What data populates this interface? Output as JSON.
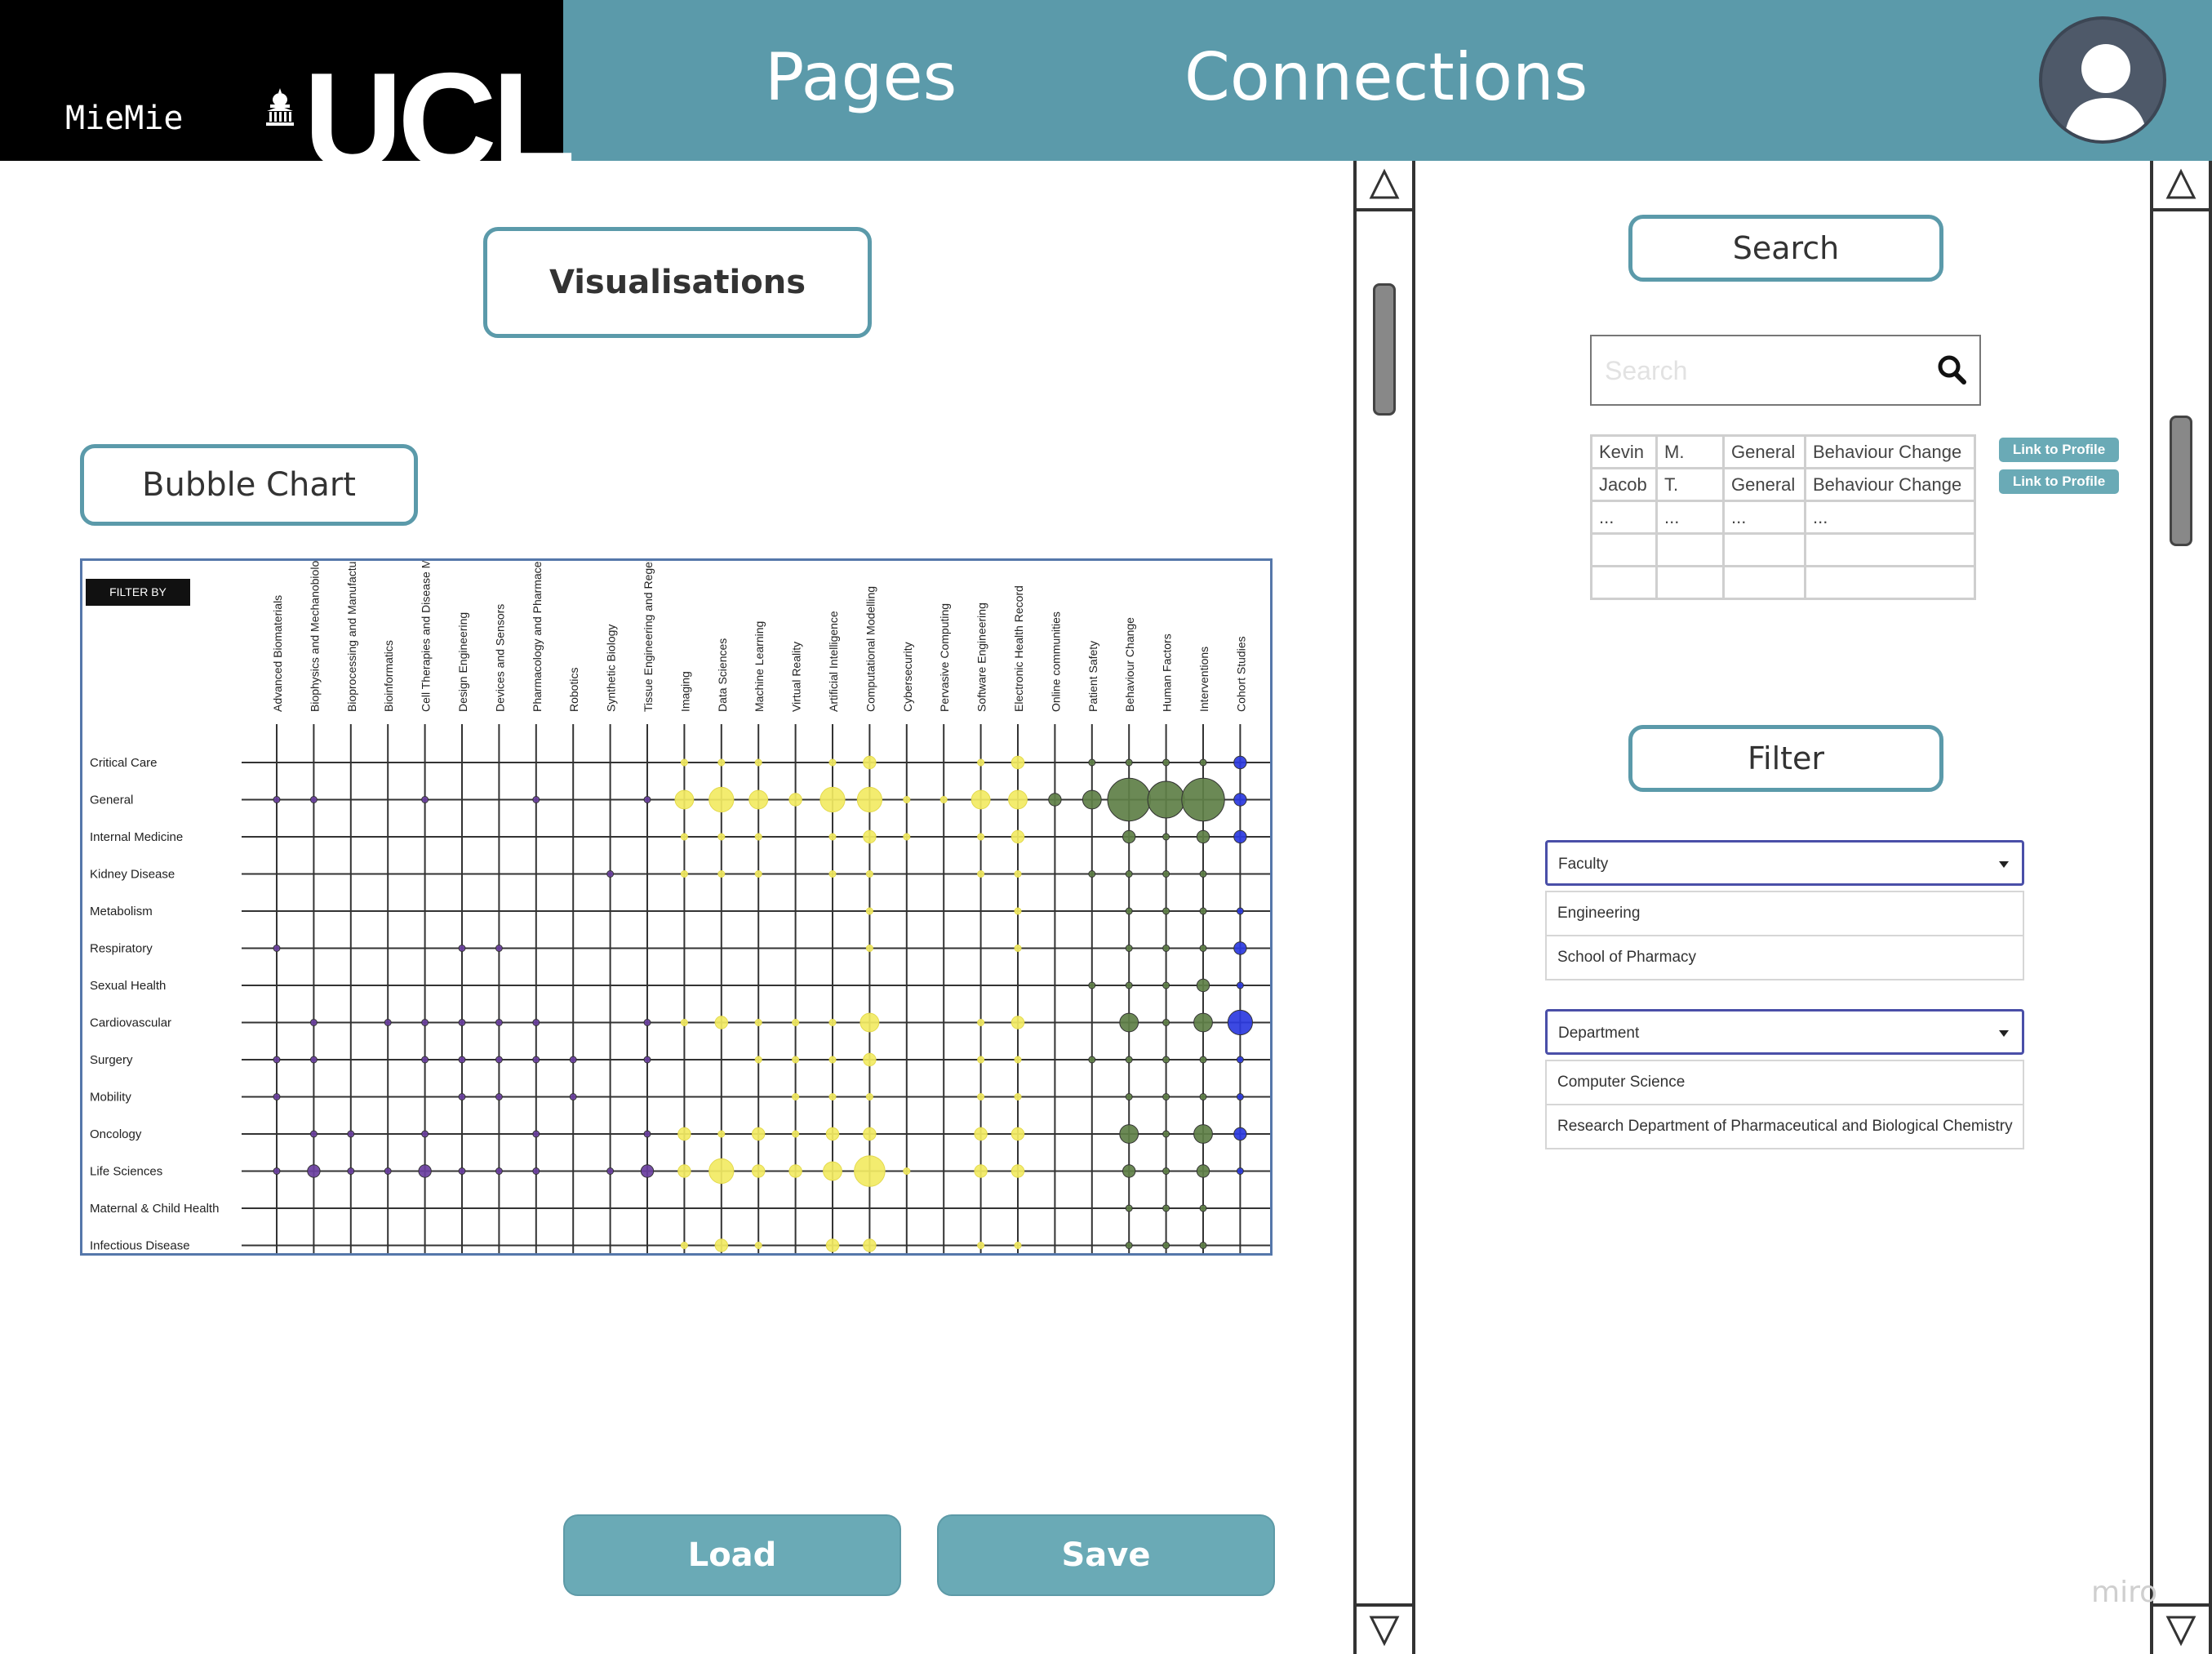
{
  "header": {
    "app_name": "MieMie",
    "logo_text": "UCL",
    "nav": [
      "Pages",
      "Connections"
    ]
  },
  "main": {
    "visualisations_label": "Visualisations",
    "bubble_chart_label": "Bubble Chart",
    "filter_by_label": "FILTER BY",
    "load_label": "Load",
    "save_label": "Save"
  },
  "chart_data": {
    "type": "bubble-matrix",
    "columns": [
      "Advanced Biomaterials",
      "Biophysics and Mechanobiology",
      "Bioprocessing and Manufacturing",
      "Bioinformatics",
      "Cell Therapies and Disease Models",
      "Design Engineering",
      "Devices and Sensors",
      "Pharmacology and Pharmaceuticals",
      "Robotics",
      "Synthetic Biology",
      "Tissue Engineering and Regenerative Medicine",
      "Imaging",
      "Data Sciences",
      "Machine Learning",
      "Virtual Reality",
      "Artificial Intelligence",
      "Computational Modelling",
      "Cybersecurity",
      "Pervasive Computing",
      "Software Engineering",
      "Electronic Health Record",
      "Online communities",
      "Patient Safety",
      "Behaviour Change",
      "Human Factors",
      "Interventions",
      "Cohort Studies"
    ],
    "rows": [
      "Critical Care",
      "General",
      "Internal Medicine",
      "Kidney Disease",
      "Metabolism",
      "Respiratory",
      "Sexual Health",
      "Cardiovascular",
      "Surgery",
      "Mobility",
      "Oncology",
      "Life Sciences",
      "Maternal & Child Health",
      "Infectious Disease"
    ],
    "column_groups": [
      {
        "color": "#6a3fa0",
        "from": 0,
        "to": 10
      },
      {
        "color": "#f2ea63",
        "from": 11,
        "to": 20
      },
      {
        "color": "#5e7f47",
        "from": 21,
        "to": 25
      },
      {
        "color": "#2b39e0",
        "from": 26,
        "to": 26
      }
    ],
    "bubble_sizes": [
      [
        0,
        0,
        0,
        0,
        0,
        0,
        0,
        0,
        0,
        0,
        0,
        1,
        1,
        1,
        0,
        1,
        2,
        0,
        0,
        1,
        2,
        0,
        1,
        1,
        1,
        1,
        2
      ],
      [
        1,
        1,
        0,
        0,
        1,
        0,
        0,
        1,
        0,
        0,
        1,
        3,
        4,
        3,
        2,
        4,
        4,
        1,
        1,
        3,
        3,
        2,
        3,
        7,
        6,
        7,
        2
      ],
      [
        0,
        0,
        0,
        0,
        0,
        0,
        0,
        0,
        0,
        0,
        0,
        1,
        1,
        1,
        0,
        1,
        2,
        1,
        0,
        1,
        2,
        0,
        0,
        2,
        1,
        2,
        2
      ],
      [
        0,
        0,
        0,
        0,
        0,
        0,
        0,
        0,
        0,
        1,
        0,
        1,
        1,
        1,
        0,
        1,
        1,
        0,
        0,
        1,
        1,
        0,
        1,
        1,
        1,
        1,
        0
      ],
      [
        0,
        0,
        0,
        0,
        0,
        0,
        0,
        0,
        0,
        0,
        0,
        0,
        0,
        0,
        0,
        0,
        1,
        0,
        0,
        0,
        1,
        0,
        0,
        1,
        1,
        1,
        1
      ],
      [
        1,
        0,
        0,
        0,
        0,
        1,
        1,
        0,
        0,
        0,
        0,
        0,
        0,
        0,
        0,
        0,
        1,
        0,
        0,
        0,
        1,
        0,
        0,
        1,
        1,
        1,
        2
      ],
      [
        0,
        0,
        0,
        0,
        0,
        0,
        0,
        0,
        0,
        0,
        0,
        0,
        0,
        0,
        0,
        0,
        0,
        0,
        0,
        0,
        0,
        0,
        1,
        1,
        1,
        2,
        1
      ],
      [
        0,
        1,
        0,
        1,
        1,
        1,
        1,
        1,
        0,
        0,
        1,
        1,
        2,
        1,
        1,
        1,
        3,
        0,
        0,
        1,
        2,
        0,
        0,
        3,
        1,
        3,
        4
      ],
      [
        1,
        1,
        0,
        0,
        1,
        1,
        1,
        1,
        1,
        0,
        1,
        0,
        0,
        1,
        1,
        1,
        2,
        0,
        0,
        1,
        1,
        0,
        1,
        1,
        1,
        1,
        1
      ],
      [
        1,
        0,
        0,
        0,
        0,
        1,
        1,
        0,
        1,
        0,
        0,
        0,
        0,
        0,
        1,
        1,
        1,
        0,
        0,
        1,
        1,
        0,
        0,
        1,
        1,
        1,
        1
      ],
      [
        0,
        1,
        1,
        0,
        1,
        0,
        0,
        1,
        0,
        0,
        1,
        2,
        1,
        2,
        1,
        2,
        2,
        0,
        0,
        2,
        2,
        0,
        0,
        3,
        1,
        3,
        2
      ],
      [
        1,
        2,
        1,
        1,
        2,
        1,
        1,
        1,
        0,
        1,
        2,
        2,
        4,
        2,
        2,
        3,
        5,
        1,
        0,
        2,
        2,
        0,
        0,
        2,
        1,
        2,
        1
      ],
      [
        0,
        0,
        0,
        0,
        0,
        0,
        0,
        0,
        0,
        0,
        0,
        0,
        0,
        0,
        0,
        0,
        0,
        0,
        0,
        0,
        0,
        0,
        0,
        1,
        1,
        1,
        0
      ],
      [
        0,
        0,
        0,
        0,
        0,
        0,
        0,
        0,
        0,
        0,
        0,
        1,
        2,
        1,
        0,
        2,
        2,
        0,
        0,
        1,
        1,
        0,
        0,
        1,
        1,
        1,
        0
      ]
    ]
  },
  "search": {
    "title": "Search",
    "placeholder": "Search",
    "results": [
      [
        "Kevin",
        "M.",
        "General",
        "Behaviour Change"
      ],
      [
        "Jacob",
        "T.",
        "General",
        "Behaviour Change"
      ],
      [
        "...",
        "...",
        "...",
        "..."
      ],
      [
        "",
        "",
        "",
        ""
      ],
      [
        "",
        "",
        "",
        ""
      ]
    ],
    "profile_link_label": "Link to Profile"
  },
  "filter": {
    "title": "Filter",
    "faculty": {
      "selected": "Faculty",
      "options": [
        "Engineering",
        "School of Pharmacy"
      ]
    },
    "department": {
      "selected": "Department",
      "options": [
        "Computer Science",
        "Research Department of Pharmaceutical and Biological Chemistry"
      ]
    }
  },
  "watermark": "miro",
  "colors": {
    "header": "#5b9aaa",
    "brand_bg": "#000000",
    "button_fill": "#6aaab6",
    "accent_border": "#5b9aaa"
  },
  "icons": {
    "avatar": "user-silhouette-icon",
    "search": "search-icon",
    "scroll_up": "triangle-up-icon",
    "scroll_down": "triangle-down-icon",
    "dropdown": "chevron-down-icon"
  }
}
